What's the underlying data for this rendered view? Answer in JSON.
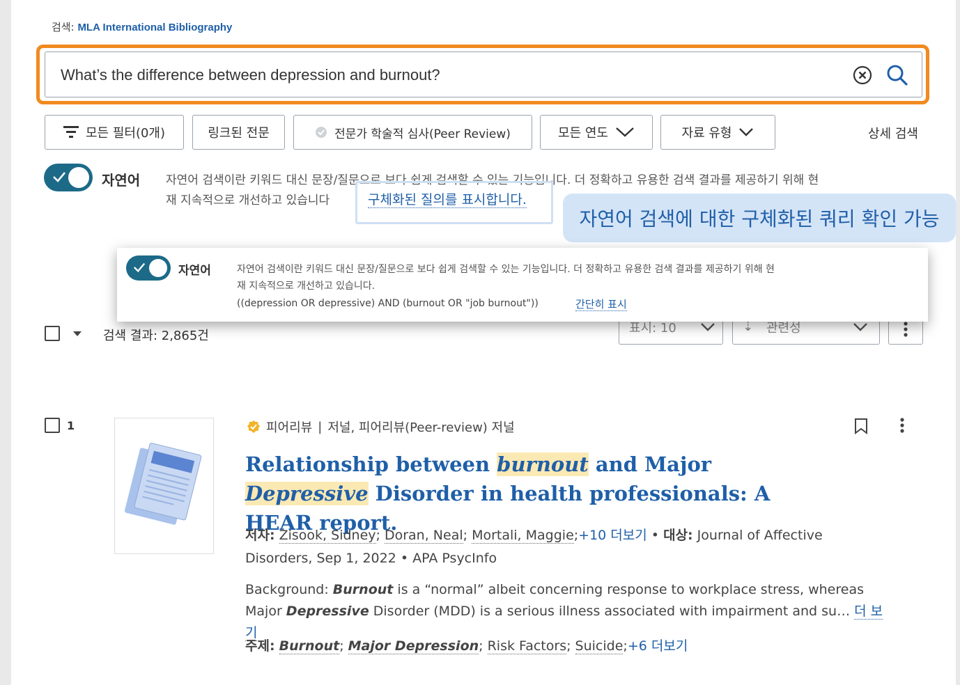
{
  "db": {
    "label": "검색:",
    "name": "MLA International Bibliography"
  },
  "search": {
    "query": "What’s the difference between depression and burnout?"
  },
  "filters": {
    "all_filters": "모든 필터(0개)",
    "linked_full_text": "링크된 전문",
    "peer_review": "전문가 학술적 심사(Peer Review)",
    "all_years": "모든 연도",
    "source_type": "자료 유형",
    "advanced_search": "상세 검색"
  },
  "natural_language": {
    "label": "자연어",
    "description_1": "자연어 검색이란 키워드 대신 문장/질문으로 보다 쉽게 검색할 수 있는 기능입니다. 더 정확하고 유용한 검색 결과를 제공하기 위해 현",
    "description_2": "재 지속적으로 개선하고 있습니다",
    "show_query_link": "구체화된 질의를 표시합니다."
  },
  "callout": {
    "text": "자연어 검색에 대한 구체화된 쿼리 확인 가능"
  },
  "popup": {
    "label": "자연어",
    "description_1": "자연어 검색이란 키워드 대신 문장/질문으로 보다 쉽게 검색할 수 있는 기능입니다. 더 정확하고 유용한 검색 결과를 제공하기 위해 현",
    "description_2": "재 지속적으로 개선하고 있습니다.",
    "query": "((depression OR depressive) AND (burnout OR \"job burnout\"))",
    "show_less_link": "간단히 표시"
  },
  "results_bar": {
    "count_label": "검색 결과: 2,865건",
    "page_size": "표시: 10",
    "sort": "관련성"
  },
  "result": {
    "index": "1",
    "meta": {
      "peer": "피어리뷰",
      "separator": "|",
      "type": "저널, 피어리뷰(Peer-review) 저널"
    },
    "title": {
      "part1": "Relationship between ",
      "hl1": "burnout",
      "part2": " and Major ",
      "hl2": "Depressive",
      "part3": " Disorder in health professionals: A HEAR report."
    },
    "authors": {
      "label": "저자:",
      "a1": "Zisook, Sidney",
      "a2": "Doran, Neal",
      "a3": "Mortali, Maggie",
      "more": "+10 더보기",
      "bullet": "•",
      "source_label": "대상:",
      "source": "Journal of Affective Disorders, Sep 1, 2022",
      "database": "APA PsycInfo"
    },
    "abstract": {
      "p1": "Background: ",
      "b1": "Burnout",
      "p2": " is a “normal” albeit concerning response to workplace stress, whereas Major ",
      "b2": "Depressive",
      "p3": " Disorder (MDD) is a serious illness associated with impairment and su…",
      "more": "더 보기"
    },
    "subjects": {
      "label": "주제:",
      "s1": "Burnout",
      "s2": "Major Depression",
      "s3": "Risk Factors",
      "s4": "Suicide",
      "more": "+6 더보기"
    }
  },
  "colors": {
    "accent": "#1f5fa8",
    "highlight_border": "#f18a1f",
    "toggle": "#1c6a88",
    "callout_bg": "#d4e4f7"
  }
}
